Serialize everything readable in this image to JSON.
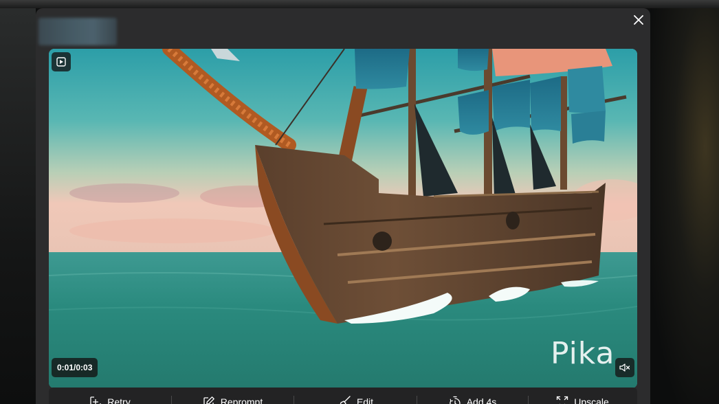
{
  "video": {
    "time_display": "0:01/0:03",
    "watermark": "Pika",
    "muted": true
  },
  "toolbar": {
    "retry_label": "Retry",
    "reprompt_label": "Reprompt",
    "edit_label": "Edit",
    "add4s_label": "Add 4s",
    "upscale_label": "Upscale"
  },
  "icons": {
    "close": "close-icon",
    "play": "play-icon",
    "mute": "speaker-muted-icon",
    "retry": "plus-square-icon",
    "reprompt": "pencil-square-icon",
    "edit": "brush-icon",
    "add4s": "timer-icon",
    "upscale": "expand-icon"
  },
  "colors": {
    "modal_bg": "#2c2c2d",
    "toolbar_bg": "#232324",
    "text": "#ffffff"
  }
}
